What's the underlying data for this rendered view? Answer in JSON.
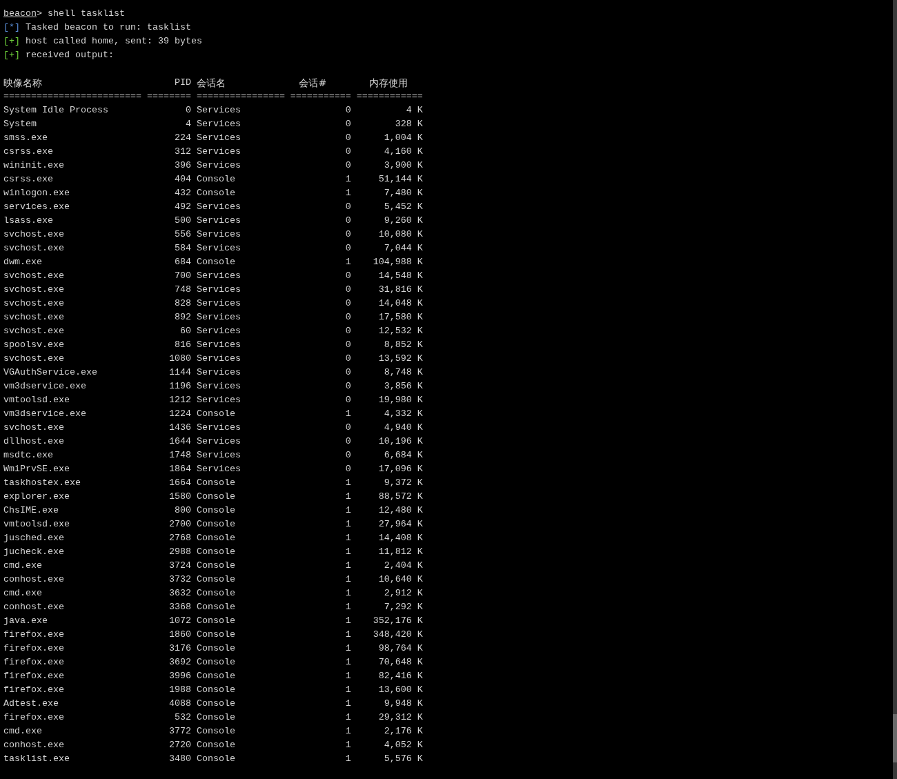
{
  "console_lines": [
    {
      "kind": "command",
      "prompt": "beacon",
      "symbol": ">",
      "text": "shell tasklist"
    },
    {
      "kind": "info",
      "marker": "[*]",
      "text": "Tasked beacon to run: tasklist"
    },
    {
      "kind": "success",
      "marker": "[+]",
      "text": "host called home, sent: 39 bytes"
    },
    {
      "kind": "success",
      "marker": "[+]",
      "text": "received output:"
    }
  ],
  "table": {
    "columns": [
      "映像名称",
      "PID",
      "会话名",
      "会话#",
      "内存使用"
    ],
    "separators": [
      "=========================",
      "========",
      "================",
      "===========",
      "============"
    ],
    "rows": [
      [
        "System Idle Process",
        "0",
        "Services",
        "0",
        "4 K"
      ],
      [
        "System",
        "4",
        "Services",
        "0",
        "328 K"
      ],
      [
        "smss.exe",
        "224",
        "Services",
        "0",
        "1,004 K"
      ],
      [
        "csrss.exe",
        "312",
        "Services",
        "0",
        "4,160 K"
      ],
      [
        "wininit.exe",
        "396",
        "Services",
        "0",
        "3,900 K"
      ],
      [
        "csrss.exe",
        "404",
        "Console",
        "1",
        "51,144 K"
      ],
      [
        "winlogon.exe",
        "432",
        "Console",
        "1",
        "7,480 K"
      ],
      [
        "services.exe",
        "492",
        "Services",
        "0",
        "5,452 K"
      ],
      [
        "lsass.exe",
        "500",
        "Services",
        "0",
        "9,260 K"
      ],
      [
        "svchost.exe",
        "556",
        "Services",
        "0",
        "10,080 K"
      ],
      [
        "svchost.exe",
        "584",
        "Services",
        "0",
        "7,044 K"
      ],
      [
        "dwm.exe",
        "684",
        "Console",
        "1",
        "104,988 K"
      ],
      [
        "svchost.exe",
        "700",
        "Services",
        "0",
        "14,548 K"
      ],
      [
        "svchost.exe",
        "748",
        "Services",
        "0",
        "31,816 K"
      ],
      [
        "svchost.exe",
        "828",
        "Services",
        "0",
        "14,048 K"
      ],
      [
        "svchost.exe",
        "892",
        "Services",
        "0",
        "17,580 K"
      ],
      [
        "svchost.exe",
        "60",
        "Services",
        "0",
        "12,532 K"
      ],
      [
        "spoolsv.exe",
        "816",
        "Services",
        "0",
        "8,852 K"
      ],
      [
        "svchost.exe",
        "1080",
        "Services",
        "0",
        "13,592 K"
      ],
      [
        "VGAuthService.exe",
        "1144",
        "Services",
        "0",
        "8,748 K"
      ],
      [
        "vm3dservice.exe",
        "1196",
        "Services",
        "0",
        "3,856 K"
      ],
      [
        "vmtoolsd.exe",
        "1212",
        "Services",
        "0",
        "19,980 K"
      ],
      [
        "vm3dservice.exe",
        "1224",
        "Console",
        "1",
        "4,332 K"
      ],
      [
        "svchost.exe",
        "1436",
        "Services",
        "0",
        "4,940 K"
      ],
      [
        "dllhost.exe",
        "1644",
        "Services",
        "0",
        "10,196 K"
      ],
      [
        "msdtc.exe",
        "1748",
        "Services",
        "0",
        "6,684 K"
      ],
      [
        "WmiPrvSE.exe",
        "1864",
        "Services",
        "0",
        "17,096 K"
      ],
      [
        "taskhostex.exe",
        "1664",
        "Console",
        "1",
        "9,372 K"
      ],
      [
        "explorer.exe",
        "1580",
        "Console",
        "1",
        "88,572 K"
      ],
      [
        "ChsIME.exe",
        "800",
        "Console",
        "1",
        "12,480 K"
      ],
      [
        "vmtoolsd.exe",
        "2700",
        "Console",
        "1",
        "27,964 K"
      ],
      [
        "jusched.exe",
        "2768",
        "Console",
        "1",
        "14,408 K"
      ],
      [
        "jucheck.exe",
        "2988",
        "Console",
        "1",
        "11,812 K"
      ],
      [
        "cmd.exe",
        "3724",
        "Console",
        "1",
        "2,404 K"
      ],
      [
        "conhost.exe",
        "3732",
        "Console",
        "1",
        "10,640 K"
      ],
      [
        "cmd.exe",
        "3632",
        "Console",
        "1",
        "2,912 K"
      ],
      [
        "conhost.exe",
        "3368",
        "Console",
        "1",
        "7,292 K"
      ],
      [
        "java.exe",
        "1072",
        "Console",
        "1",
        "352,176 K"
      ],
      [
        "firefox.exe",
        "1860",
        "Console",
        "1",
        "348,420 K"
      ],
      [
        "firefox.exe",
        "3176",
        "Console",
        "1",
        "98,764 K"
      ],
      [
        "firefox.exe",
        "3692",
        "Console",
        "1",
        "70,648 K"
      ],
      [
        "firefox.exe",
        "3996",
        "Console",
        "1",
        "82,416 K"
      ],
      [
        "firefox.exe",
        "1988",
        "Console",
        "1",
        "13,600 K"
      ],
      [
        "Adtest.exe",
        "4088",
        "Console",
        "1",
        "9,948 K"
      ],
      [
        "firefox.exe",
        "532",
        "Console",
        "1",
        "29,312 K"
      ],
      [
        "cmd.exe",
        "3772",
        "Console",
        "1",
        "2,176 K"
      ],
      [
        "conhost.exe",
        "2720",
        "Console",
        "1",
        "4,052 K"
      ],
      [
        "tasklist.exe",
        "3480",
        "Console",
        "1",
        "5,576 K"
      ]
    ]
  }
}
